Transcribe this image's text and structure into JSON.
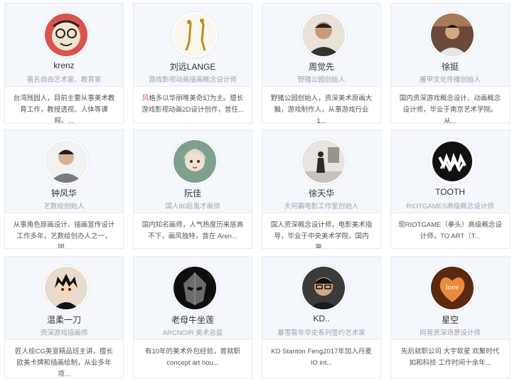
{
  "cards": [
    {
      "name": "krenz",
      "title": "著名自由艺术家、教育家",
      "desc": "台湾残园人，目前主要从事美术教育工作，教授透视、人体等课程。..."
    },
    {
      "name": "刘远LANGE",
      "title": "游戏影视动画插画概念设计师",
      "desc_prefix": "风",
      "desc": "格多以华丽唯美奇幻为主。擅长游戏影视动画2D设计创作，曾任..."
    },
    {
      "name": "周觉先",
      "title": "野猪公园创始人",
      "desc": "野猪公园创始人，资深美术原画大触，游戏制作人，从事游戏行业1..."
    },
    {
      "name": "徐挺",
      "title": "雁甲文化传播创始人",
      "desc": "国内资深游戏概念设计、动画概念设计师，毕业于南京艺术学院。从..."
    },
    {
      "name": "钟风华",
      "title": "艺数绘创始人",
      "desc": "从事角色原画设计、插画宣传设计工作多年，艺数绘创办人之一，团..."
    },
    {
      "name": "阮佳",
      "title": "国人80后鬼才画师",
      "desc": "国内知名画师，人气热度历来居高不下，画风独特，曾在 Aren..."
    },
    {
      "name": "徐天华",
      "title": "天何霸电影工作室创始人",
      "desc": "国人资深概念设计师，电影美术指导，毕业于中央美术学院，国内第..."
    },
    {
      "name": "TOOTH",
      "title": "RIOTGAMES高级概念设计师",
      "desc": "现RIOTGAME（拳头）高级概念设计师，TO ART（T..."
    },
    {
      "name": "温柔一刀",
      "title": "资深游戏插画师",
      "desc": "匠人绘CG美宣精品班主讲，擅长欧美卡牌和插画绘制，从业多年项..."
    },
    {
      "name": "老母牛坐莲",
      "title": "ARCNOIR 美术总监",
      "desc": "有10年的美术外包经验，曾就职concept art hou..."
    },
    {
      "name": "KD..",
      "title": "暴雪嘉年华史系列签约艺术家",
      "desc": "KD Stanton Feng2017年加入丹麦IO int..."
    },
    {
      "name": "星空",
      "title": "网易资深场景设计师",
      "desc": "先后就职公司 大宇软星 欢聚时代 如和科技 工作时间十余年..."
    }
  ],
  "avatars": [
    "face-sketch-icon",
    "figure-sculpture-icon",
    "man-portrait-icon",
    "man-studio-icon",
    "man-portrait-icon",
    "woman-painting-icon",
    "man-gallery-icon",
    "monster-mouth-logo",
    "anime-boy-icon",
    "dark-mask-icon",
    "man-glasses-icon",
    "love-heart-icon"
  ],
  "colors": {
    "card_top_bg": "#f4f7fb",
    "border": "#e6eaf0",
    "title": "#9aa3ae",
    "text": "#555555",
    "highlight": "#e2574c"
  }
}
